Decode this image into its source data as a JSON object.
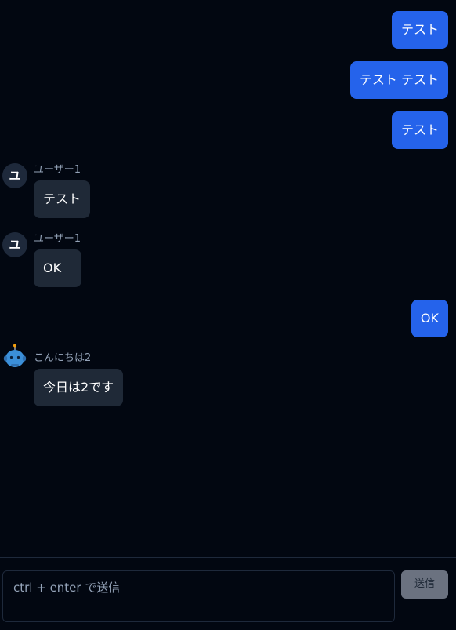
{
  "messages": [
    {
      "type": "self",
      "text": "テスト"
    },
    {
      "type": "self",
      "text": "テスト テスト"
    },
    {
      "type": "self",
      "text": "テスト"
    },
    {
      "type": "other",
      "avatar": "ユ",
      "sender": "ユーザー1",
      "text": "テスト"
    },
    {
      "type": "other",
      "avatar": "ユ",
      "sender": "ユーザー1",
      "text": "OK"
    },
    {
      "type": "self",
      "text": "OK"
    },
    {
      "type": "bot",
      "avatar_icon": "robot-icon",
      "sender": "こんにちは2",
      "text": "今日は2です"
    }
  ],
  "composer": {
    "placeholder": "ctrl + enter で送信",
    "value": "",
    "send_label": "送信"
  },
  "colors": {
    "background": "#020711",
    "self_bubble": "#2563eb",
    "other_bubble": "#1f2937",
    "avatar_bg": "#1e293b",
    "sender_text": "#94a3b8",
    "send_button": "#6b7280",
    "robot": "#3b8fd9"
  }
}
